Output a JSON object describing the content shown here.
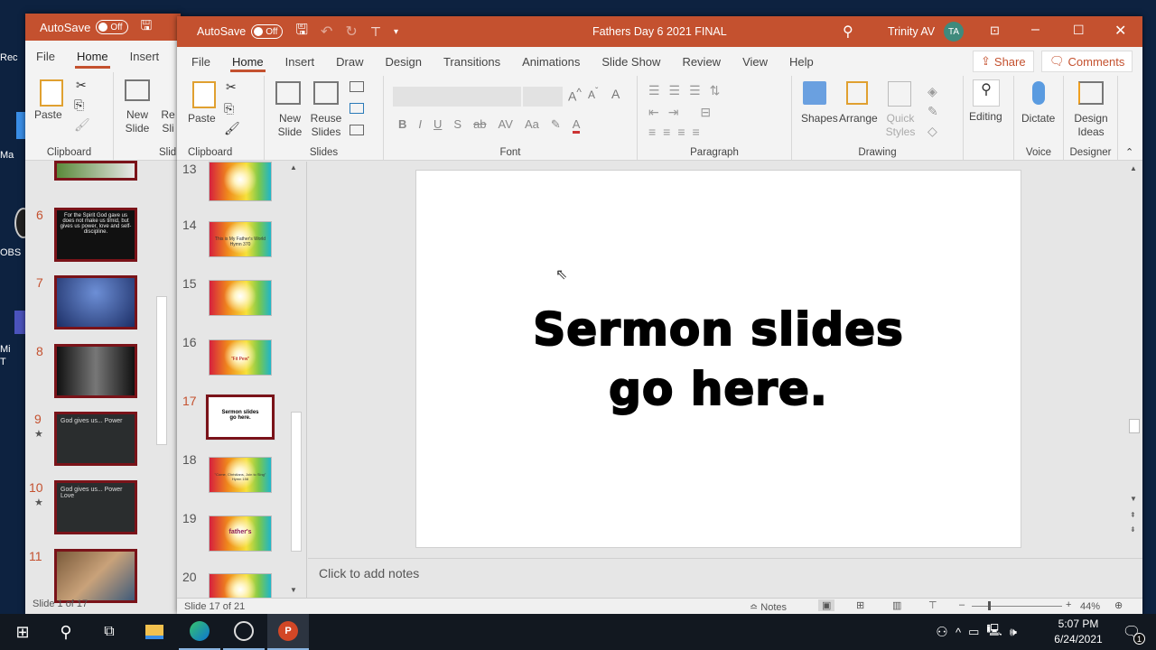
{
  "desktop": {
    "icons": [
      "Rec",
      "Ma",
      "OBS",
      "Mi\nT"
    ]
  },
  "back_window": {
    "autosave_label": "AutoSave",
    "autosave_state": "Off",
    "tabs": [
      "File",
      "Home",
      "Insert"
    ],
    "ribbon": {
      "paste": "Paste",
      "new_slide": "New Slide",
      "reuse": "Re Sli",
      "clipboard_group": "Clipboard",
      "slides_group": "Slid"
    },
    "thumbnails": [
      {
        "num": "6",
        "text": "For the Spirit God gave us does not make us timid, but gives us power, love and self-discipline."
      },
      {
        "num": "7"
      },
      {
        "num": "8"
      },
      {
        "num": "9",
        "star": "★",
        "text": "God gives us... Power"
      },
      {
        "num": "10",
        "star": "★",
        "text": "God gives us... Power Love"
      },
      {
        "num": "11"
      }
    ],
    "status": "Slide 1 of 17"
  },
  "window": {
    "title": "Fathers Day 6 2021 FINAL",
    "autosave_label": "AutoSave",
    "autosave_state": "Off",
    "user": "Trinity AV",
    "user_initials": "TA",
    "accent": "#c4512f",
    "tabs": [
      "File",
      "Home",
      "Insert",
      "Draw",
      "Design",
      "Transitions",
      "Animations",
      "Slide Show",
      "Review",
      "View",
      "Help"
    ],
    "active_tab": "Home",
    "share": "Share",
    "comments": "Comments",
    "ribbon": {
      "paste": "Paste",
      "clipboard": "Clipboard",
      "new_slide": "New Slide",
      "reuse_slides": "Reuse Slides",
      "slides": "Slides",
      "font": "Font",
      "bold": "B",
      "italic": "I",
      "underline": "U",
      "shadow": "S",
      "strike": "ab",
      "spacing": "AV",
      "case": "Aa",
      "paragraph": "Paragraph",
      "shapes": "Shapes",
      "arrange": "Arrange",
      "quick_styles": "Quick Styles",
      "drawing": "Drawing",
      "editing": "Editing",
      "dictate": "Dictate",
      "voice": "Voice",
      "design_ideas": "Design Ideas",
      "designer": "Designer"
    },
    "thumbnails": [
      {
        "num": "13",
        "type": "rainbow"
      },
      {
        "num": "14",
        "type": "rainbow",
        "text": "This is My Father's World Hymn 370"
      },
      {
        "num": "15",
        "type": "rainbow"
      },
      {
        "num": "16",
        "type": "rainbow",
        "text": "\"Fit Pew\""
      },
      {
        "num": "17",
        "type": "white",
        "text": "Sermon slides go here."
      },
      {
        "num": "18",
        "type": "rainbow",
        "text": "\"Come, Christians, Join to Sing\" Hymn 158"
      },
      {
        "num": "19",
        "type": "rainbow",
        "text": "father's"
      },
      {
        "num": "20",
        "type": "rainbow"
      }
    ],
    "slide": {
      "line1": "Sermon slides",
      "line2": "go here."
    },
    "notes_placeholder": "Click to add notes",
    "status": {
      "slide": "Slide 17 of 21",
      "notes": "Notes",
      "zoom": "44%"
    }
  },
  "taskbar": {
    "time": "5:07 PM",
    "date": "6/24/2021",
    "notification_count": "1"
  }
}
